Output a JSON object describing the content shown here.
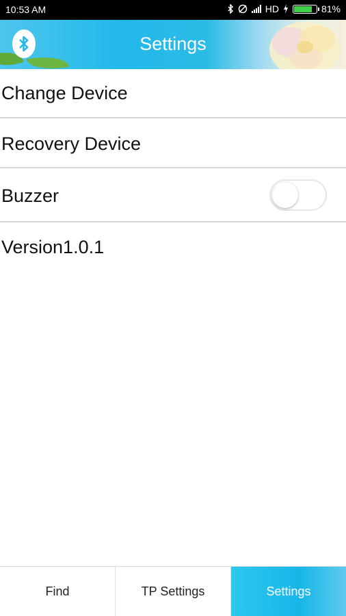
{
  "status_bar": {
    "time": "10:53 AM",
    "network": "HD",
    "battery": "81%",
    "battery_level": 0.81
  },
  "header": {
    "title": "Settings"
  },
  "settings": {
    "change_device": "Change Device",
    "recovery_device": "Recovery Device",
    "buzzer": "Buzzer",
    "buzzer_enabled": false,
    "version": "Version1.0.1"
  },
  "bottom_nav": {
    "tabs": [
      {
        "label": "Find",
        "active": false
      },
      {
        "label": "TP Settings",
        "active": false
      },
      {
        "label": "Settings",
        "active": true
      }
    ]
  },
  "colors": {
    "accent": "#22b8ea",
    "divider": "#d6d6d6"
  },
  "icons": [
    "bluetooth-icon",
    "do-not-disturb-icon",
    "signal-icon",
    "charging-icon",
    "battery-icon"
  ]
}
